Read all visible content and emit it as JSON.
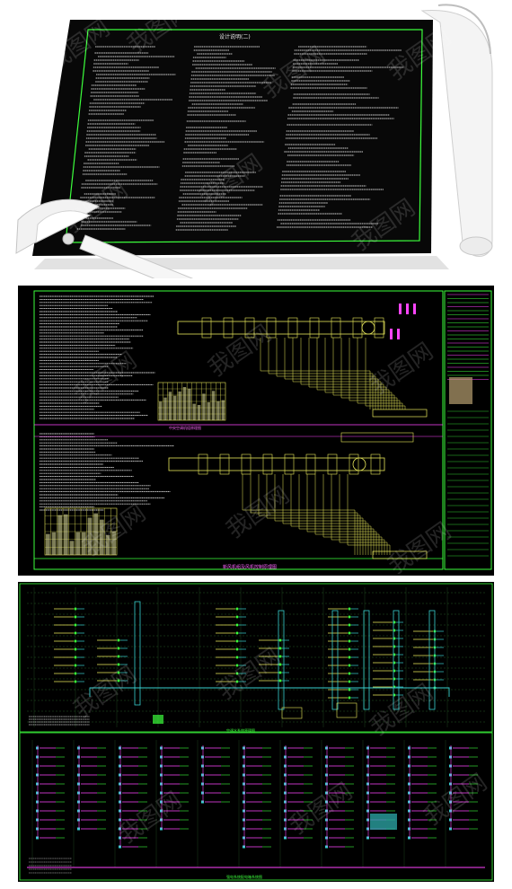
{
  "watermark": {
    "text": "我图网",
    "color": "#ffffff"
  },
  "panel1": {
    "title": "设计说明(二)",
    "frame_color": "#3cff3c",
    "background": "#000000",
    "text_color": "#e0e0e0"
  },
  "panel2": {
    "top_diagram_caption": "中央空调机组原理图",
    "bottom_diagram_caption": "新风机组及风机控制原理图",
    "frame_color": "#3cff3c",
    "line_color": "#e8e85a",
    "accent_color": "#ff44ff",
    "cyan_color": "#39d0d0"
  },
  "panel3": {
    "upper_caption": "空调水系统原理图",
    "lower_caption": "强电系统配电箱系统图",
    "frame_color": "#3cff3c",
    "line_color": "#e8e85a",
    "accent_color": "#ff44ff",
    "cyan_color": "#39d0d0"
  }
}
